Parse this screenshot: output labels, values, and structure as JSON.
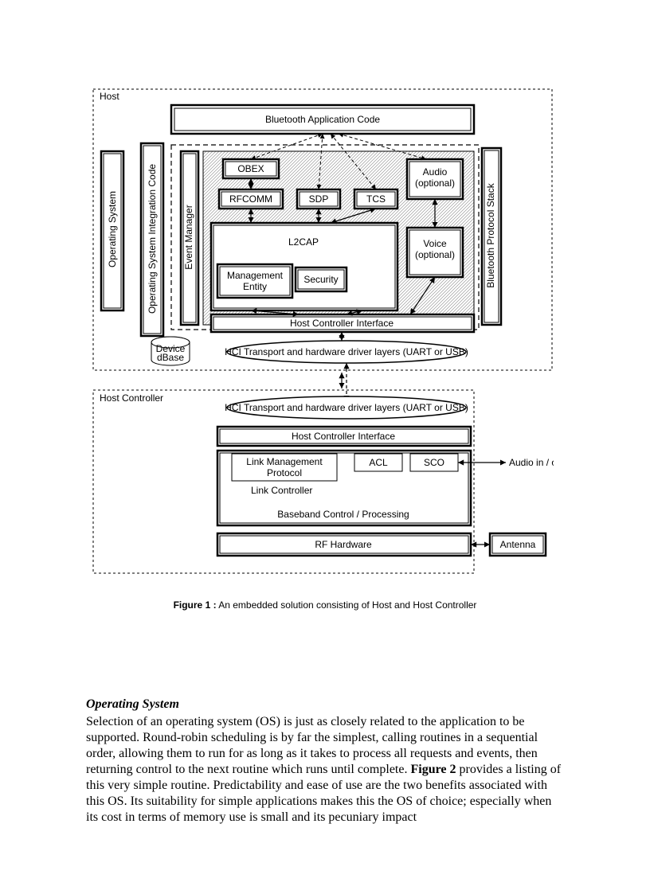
{
  "figure": {
    "caption_bold": "Figure 1  :",
    "caption_rest": " An embedded solution consisting of Host and Host Controller"
  },
  "diagram": {
    "host_label": "Host",
    "host_controller_label": "Host Controller",
    "operating_system": "Operating System",
    "os_integration": "Operating System Integration Code",
    "event_manager": "Event Manager",
    "bt_protocol_stack": "Bluetooth Protocol Stack",
    "bluetooth_app_code": "Bluetooth Application Code",
    "obex": "OBEX",
    "rfcomm": "RFCOMM",
    "sdp": "SDP",
    "tcs": "TCS",
    "audio_opt": "Audio",
    "audio_opt2": "(optional)",
    "l2cap": "L2CAP",
    "voice_opt": "Voice",
    "voice_opt2": "(optional)",
    "mgmt_entity1": "Management",
    "mgmt_entity2": "Entity",
    "security": "Security",
    "hci_top": "Host Controller Interface",
    "hci_transport": "HCI Transport and hardware driver layers  (UART or  USB)",
    "device_dbase1": "Device",
    "device_dbase2": "dBase",
    "hci_controller": "Host Controller Interface",
    "lmp1": "Link Management",
    "lmp2": "Protocol",
    "acl": "ACL",
    "sco": "SCO",
    "link_controller": "Link Controller",
    "baseband": "Baseband Control / Processing",
    "rf_hw": "RF Hardware",
    "audio_io": "Audio in / out",
    "antenna": "Antenna"
  },
  "section": {
    "heading": "Operating System",
    "para": "Selection of an operating system (OS) is just as closely related to the application to be supported.  Round-robin scheduling is by far the simplest,  calling routines in a sequential order,  allowing them to run for as long as it takes to process all requests and events,  then returning control to the next routine which runs until complete.  ",
    "fig2": "Figure 2",
    "para2": " provides a listing of this very simple routine.  Predictability and ease of use are the two benefits associated with this OS.  Its suitability for simple applications makes this the OS of choice;  especially when its cost in terms of memory use is small and its pecuniary impact"
  }
}
